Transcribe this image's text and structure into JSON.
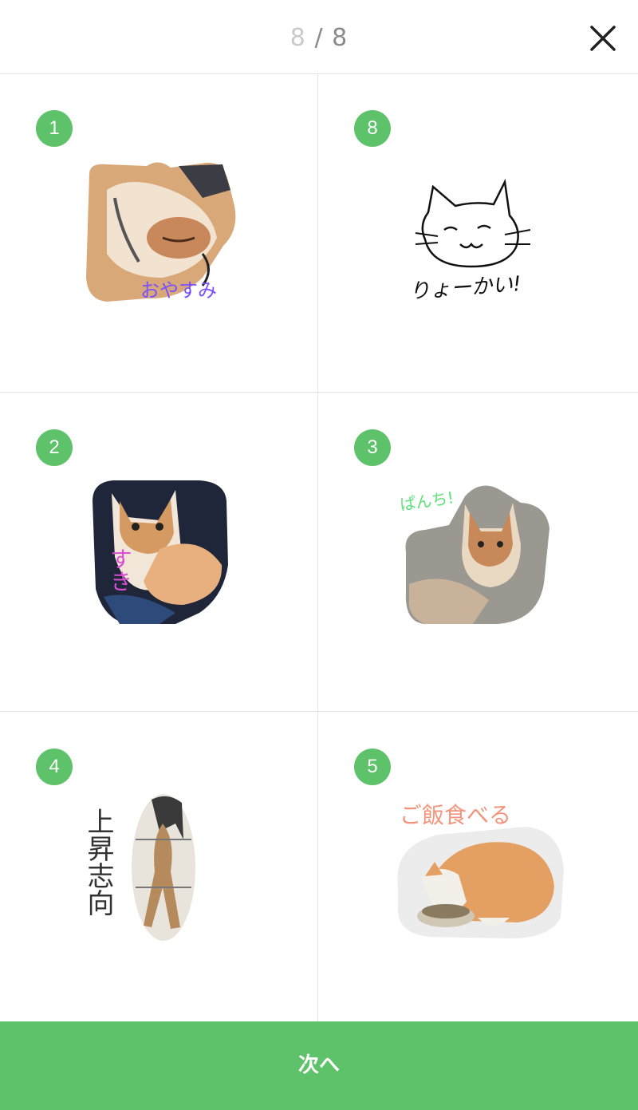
{
  "header": {
    "counter_current": "8",
    "counter_separator": "/",
    "counter_total": "8",
    "close_icon": "close-icon"
  },
  "cells": [
    {
      "badge": "1",
      "caption": "おやすみ",
      "caption_color": "#7a4fff"
    },
    {
      "badge": "8",
      "caption": "りょーかい!",
      "caption_color": "#111111"
    },
    {
      "badge": "2",
      "caption": "すき",
      "caption_color": "#d94fd2"
    },
    {
      "badge": "3",
      "caption": "ぱんち!",
      "caption_color": "#5fe07a"
    },
    {
      "badge": "4",
      "caption": "上昇志向",
      "caption_color": "#333333"
    },
    {
      "badge": "5",
      "caption": "ご飯食べる",
      "caption_color": "#f3957c"
    }
  ],
  "footer": {
    "next_label": "次へ"
  },
  "colors": {
    "accent": "#5ec26a",
    "divider": "#e4e4e4"
  }
}
